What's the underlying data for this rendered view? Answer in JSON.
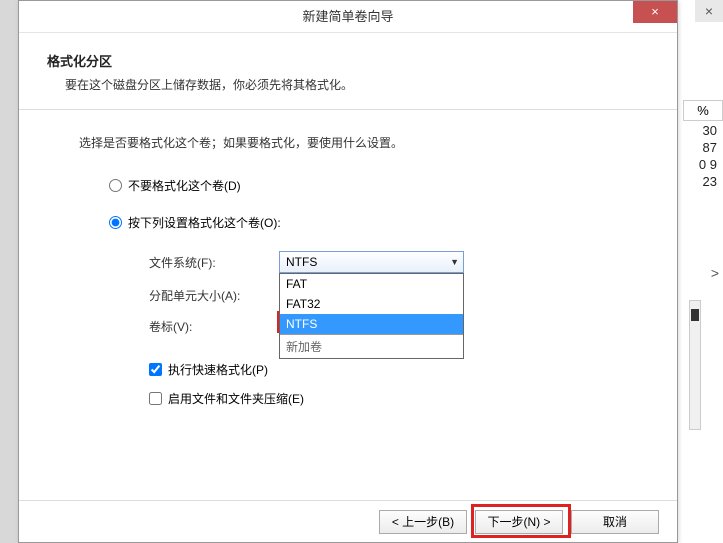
{
  "bg": {
    "close": "×",
    "col_header": "%",
    "values": [
      "30",
      "87",
      "0 9",
      "23"
    ],
    "scroll_arrow": ">"
  },
  "dialog": {
    "title": "新建简单卷向导",
    "close": "×",
    "header": {
      "title": "格式化分区",
      "desc": "要在这个磁盘分区上储存数据，你必须先将其格式化。"
    },
    "instruction": "选择是否要格式化这个卷；如果要格式化，要使用什么设置。",
    "radio_no_format": "不要格式化这个卷(D)",
    "radio_format": "按下列设置格式化这个卷(O):",
    "fields": {
      "fs_label": "文件系统(F):",
      "fs_value": "NTFS",
      "alloc_label": "分配单元大小(A):",
      "vol_label": "卷标(V):"
    },
    "dropdown_options": {
      "fat": "FAT",
      "fat32": "FAT32",
      "ntfs": "NTFS",
      "partial": "新加卷"
    },
    "cb_quick": "执行快速格式化(P)",
    "cb_compress": "启用文件和文件夹压缩(E)",
    "buttons": {
      "back": "< 上一步(B)",
      "next": "下一步(N) >",
      "cancel": "取消"
    }
  }
}
